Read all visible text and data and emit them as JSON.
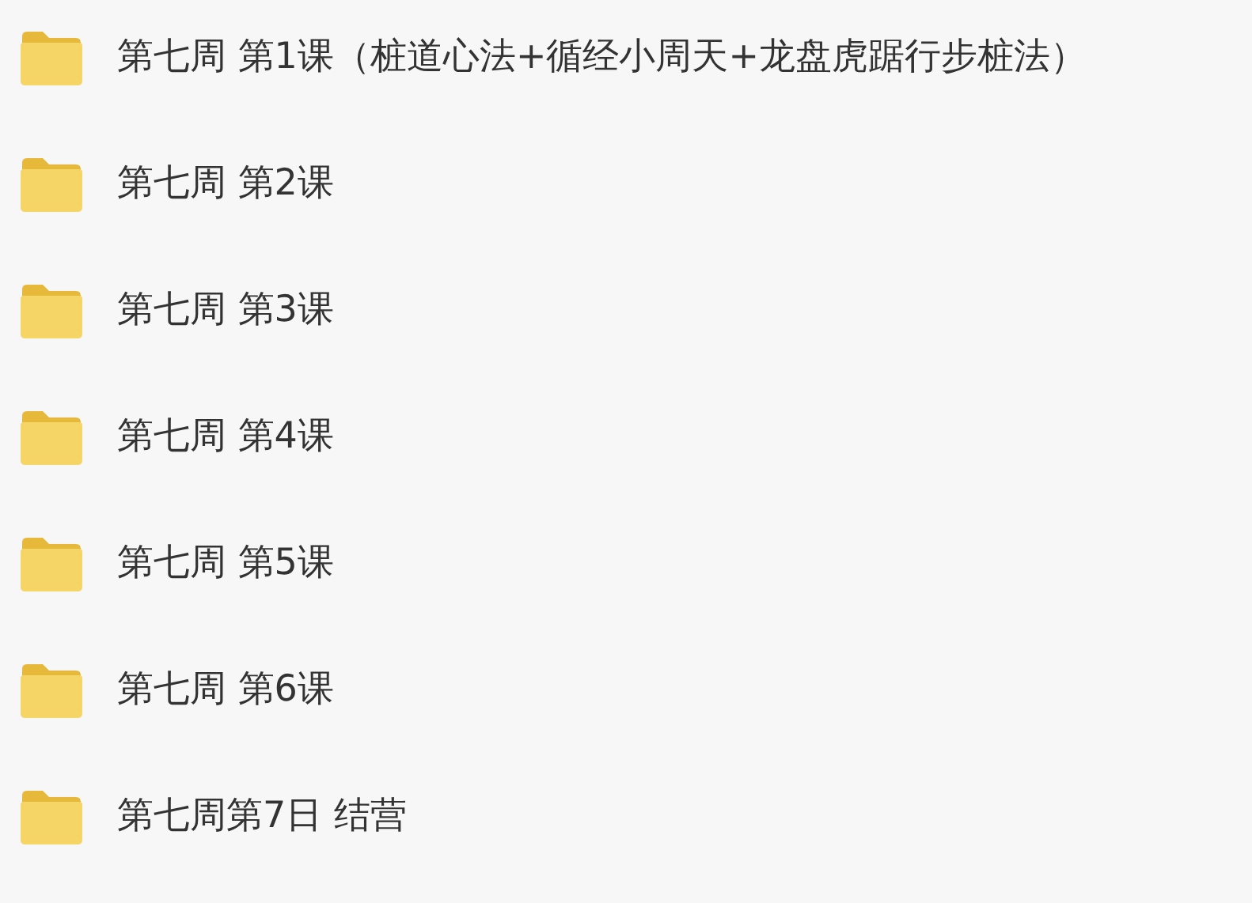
{
  "folders": [
    {
      "name": "第七周 第1课（桩道心法+循经小周天+龙盘虎踞行步桩法）"
    },
    {
      "name": "第七周 第2课"
    },
    {
      "name": "第七周 第3课"
    },
    {
      "name": "第七周 第4课"
    },
    {
      "name": "第七周 第5课"
    },
    {
      "name": "第七周 第6课"
    },
    {
      "name": "第七周第7日 结营"
    }
  ]
}
